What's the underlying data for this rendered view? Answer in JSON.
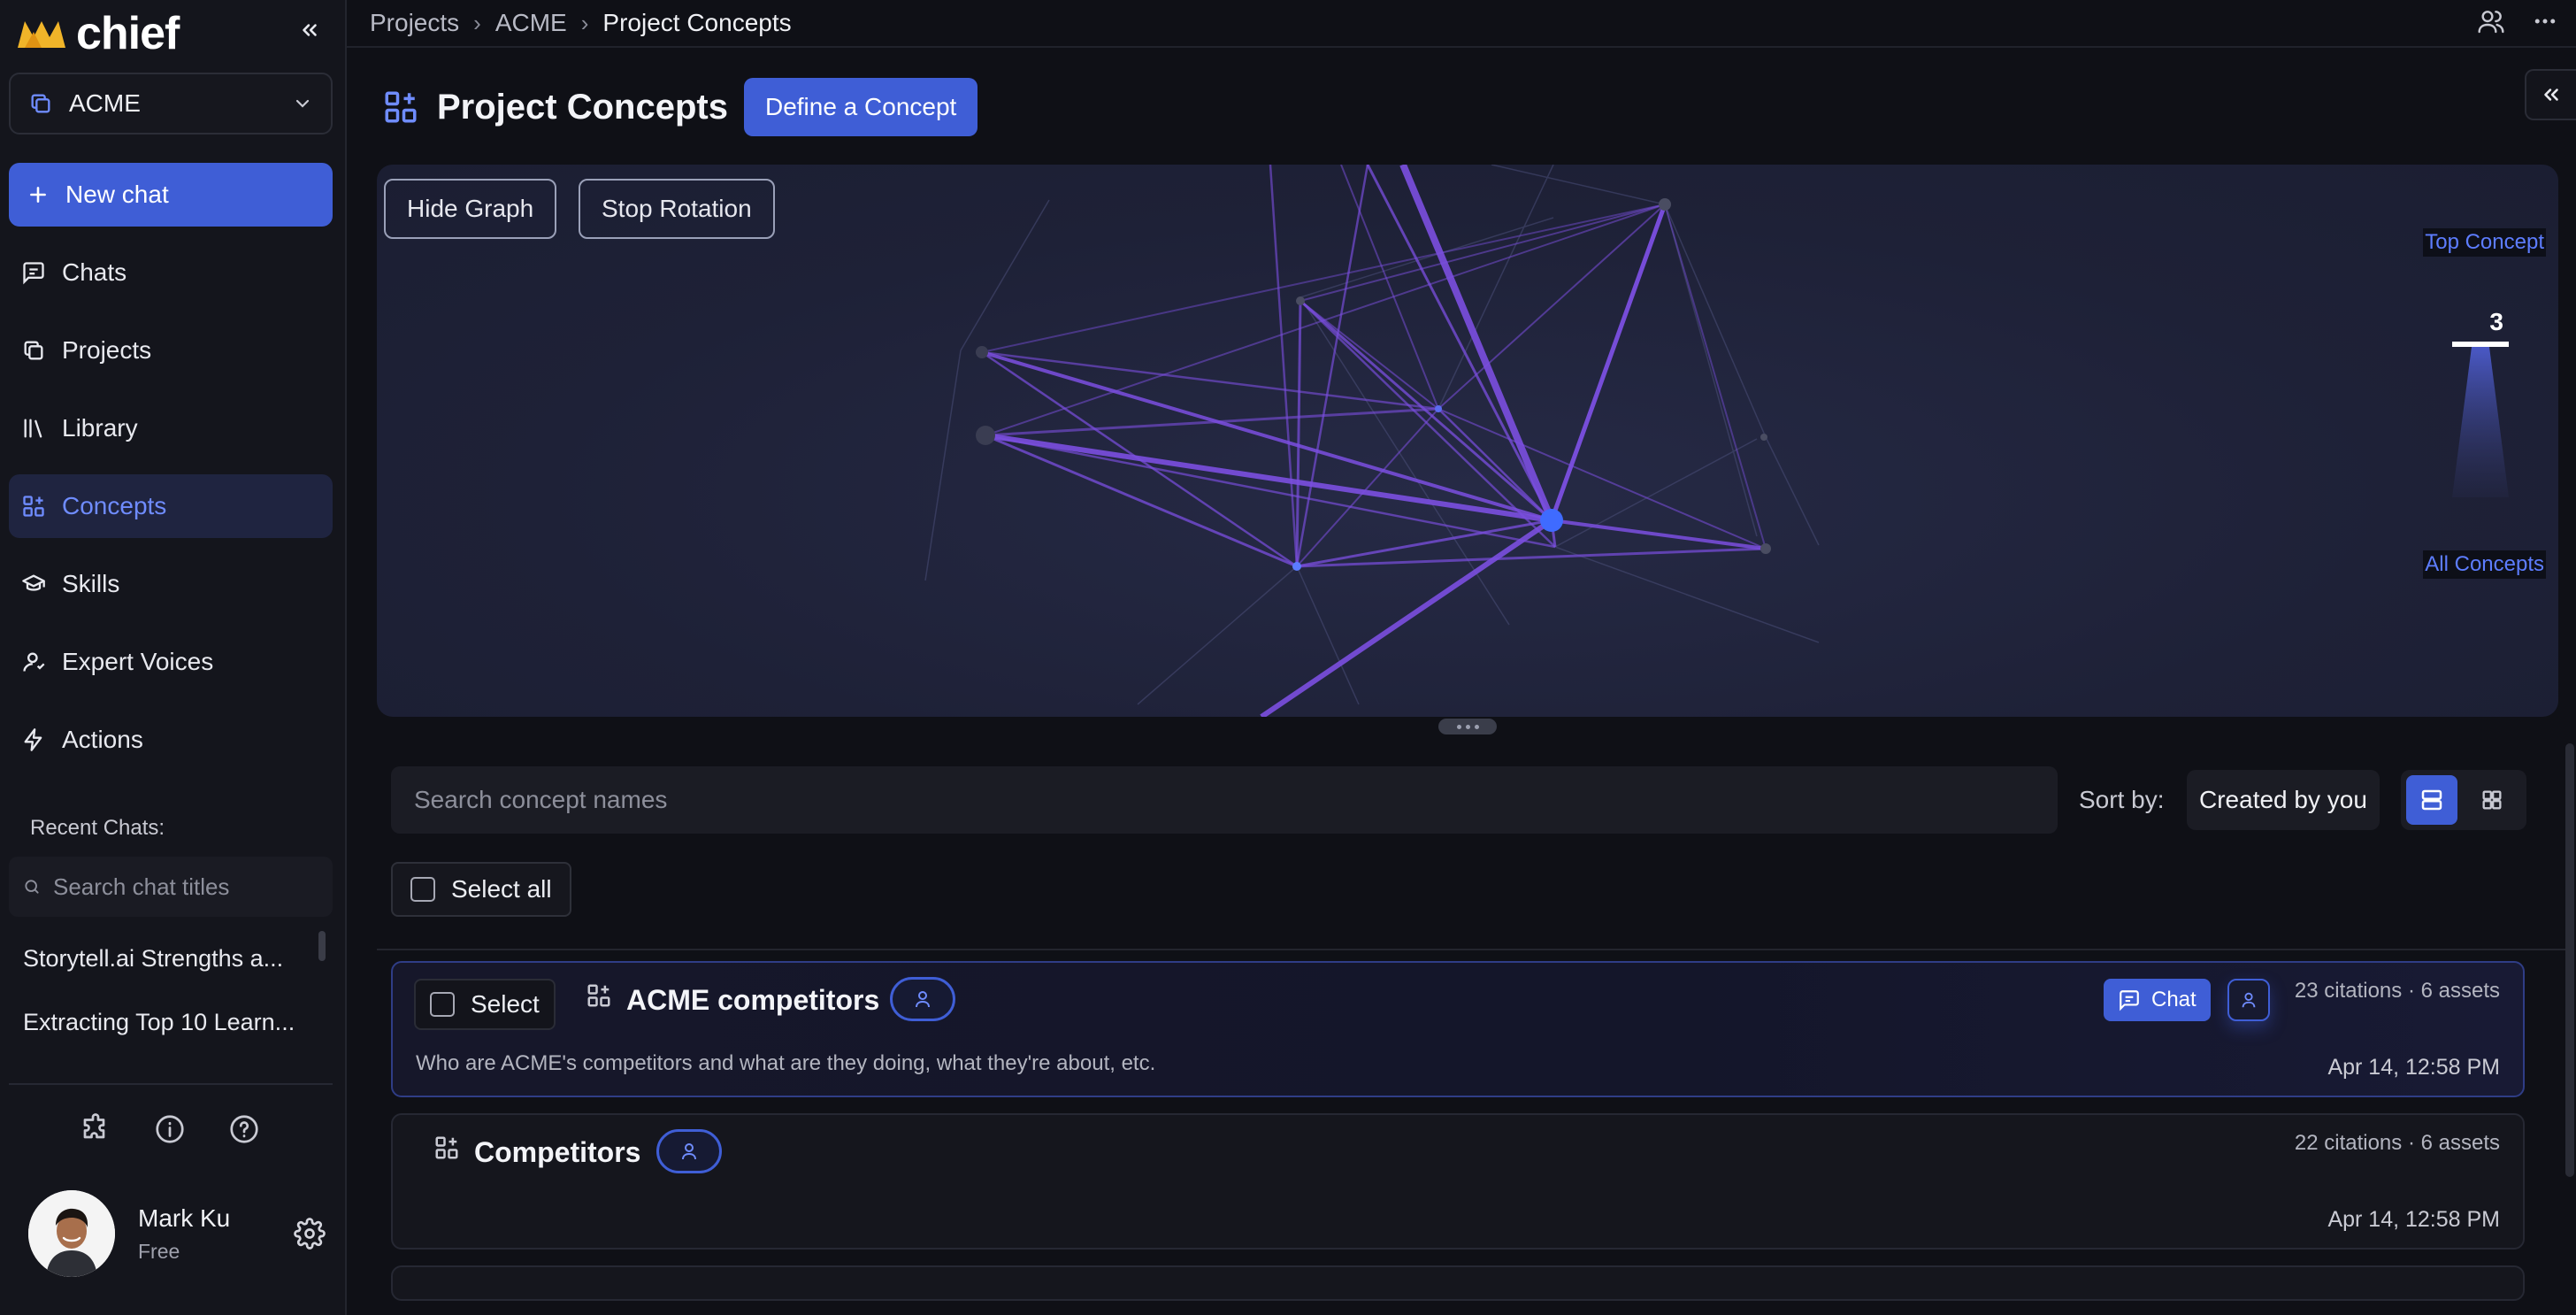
{
  "app": {
    "brand": "chief",
    "workspace": "ACME"
  },
  "sidebar": {
    "new_chat": "New chat",
    "items": [
      {
        "label": "Chats",
        "icon": "message-square-icon"
      },
      {
        "label": "Projects",
        "icon": "copy-icon"
      },
      {
        "label": "Library",
        "icon": "library-icon"
      },
      {
        "label": "Concepts",
        "icon": "concepts-grid-icon",
        "active": true
      },
      {
        "label": "Skills",
        "icon": "graduation-cap-icon"
      },
      {
        "label": "Expert Voices",
        "icon": "user-icon"
      },
      {
        "label": "Actions",
        "icon": "zap-icon"
      }
    ],
    "recent_title": "Recent Chats:",
    "search_placeholder": "Search chat titles",
    "recent_chats": [
      "Storytell.ai Strengths a...",
      "Extracting Top 10 Learn..."
    ],
    "user": {
      "name": "Mark Ku",
      "plan": "Free"
    }
  },
  "breadcrumb": [
    "Projects",
    "ACME",
    "Project Concepts"
  ],
  "page": {
    "title": "Project Concepts",
    "define_button": "Define a Concept"
  },
  "graph": {
    "hide_button": "Hide Graph",
    "rotation_button": "Stop Rotation",
    "legend_top": "Top Concept",
    "legend_all": "All Concepts",
    "legend_count": "3"
  },
  "list": {
    "search_placeholder": "Search concept names",
    "sort_label": "Sort by:",
    "sort_value": "Created by you",
    "select_all": "Select all",
    "select_label": "Select",
    "chat_label": "Chat",
    "concepts": [
      {
        "title": "ACME competitors",
        "description": "Who are ACME's competitors and what are they doing, what they're about, etc.",
        "meta": "23 citations · 6 assets",
        "date": "Apr 14, 12:58 PM"
      },
      {
        "title": "Competitors",
        "description": "",
        "meta": "22 citations · 6 assets",
        "date": "Apr 14, 12:58 PM"
      }
    ]
  },
  "colors": {
    "accent": "#3f5ed6",
    "edge": "#8b5cf6",
    "background": "#0f1016"
  }
}
